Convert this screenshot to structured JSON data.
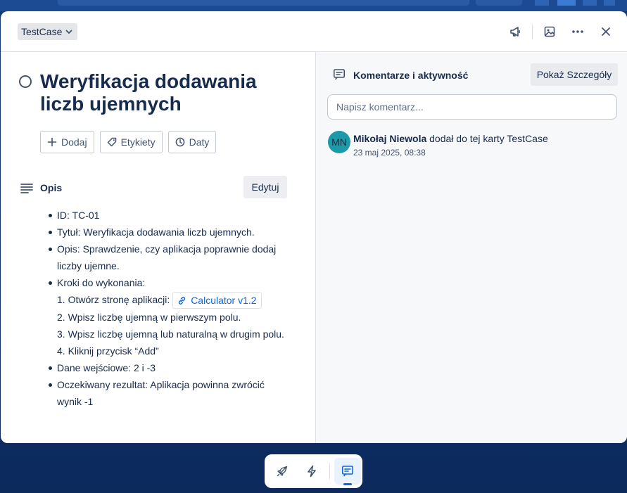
{
  "card_type": "TestCase",
  "header_icons": [
    "megaphone-icon",
    "image-icon",
    "more-icon",
    "close-icon"
  ],
  "title": "Weryfikacja dodawania liczb ujemnych",
  "actions": [
    {
      "label": "Dodaj",
      "icon": "plus-icon"
    },
    {
      "label": "Etykiety",
      "icon": "tag-icon"
    },
    {
      "label": "Daty",
      "icon": "clock-icon"
    }
  ],
  "description": {
    "label": "Opis",
    "edit_label": "Edytuj",
    "items": [
      {
        "text": "ID: TC-01",
        "bullet": true
      },
      {
        "text": "Tytuł: Weryfikacja dodawania liczb ujemnych.",
        "bullet": true
      },
      {
        "text": "Opis: Sprawdzenie, czy aplikacja poprawnie dodaj liczby ujemne.",
        "bullet": true
      },
      {
        "text": "Kroki do wykonania:",
        "bullet": true
      },
      {
        "text": "1. Otwórz stronę aplikacji:",
        "bullet": false,
        "link": "Calculator v1.2"
      },
      {
        "text": "2. Wpisz liczbę ujemną w pierwszym polu.",
        "bullet": false
      },
      {
        "text": "3. Wpisz liczbę ujemną lub naturalną w drugim polu.",
        "bullet": false
      },
      {
        "text": "4. Kliknij przycisk “Add”",
        "bullet": false
      },
      {
        "text": "Dane wejściowe: 2 i -3",
        "bullet": true
      },
      {
        "text": "Oczekiwany rezultat: Aplikacja powinna zwrócić wynik -1",
        "bullet": true
      }
    ]
  },
  "activity": {
    "title": "Komentarze i aktywność",
    "details_label": "Pokaż Szczegóły",
    "comment_placeholder": "Napisz komentarz...",
    "entries": [
      {
        "initials": "MN",
        "user": "Mikołaj Niewola",
        "action": "dodał do tej karty TestCase",
        "time": "23 maj 2025, 08:38"
      }
    ]
  },
  "colors": {
    "accent": "#0c66e4",
    "avatar": "#1d9aaa",
    "title": "#172b4d"
  },
  "dock_icons": [
    "rocket-icon",
    "bolt-icon",
    "comment-icon"
  ]
}
